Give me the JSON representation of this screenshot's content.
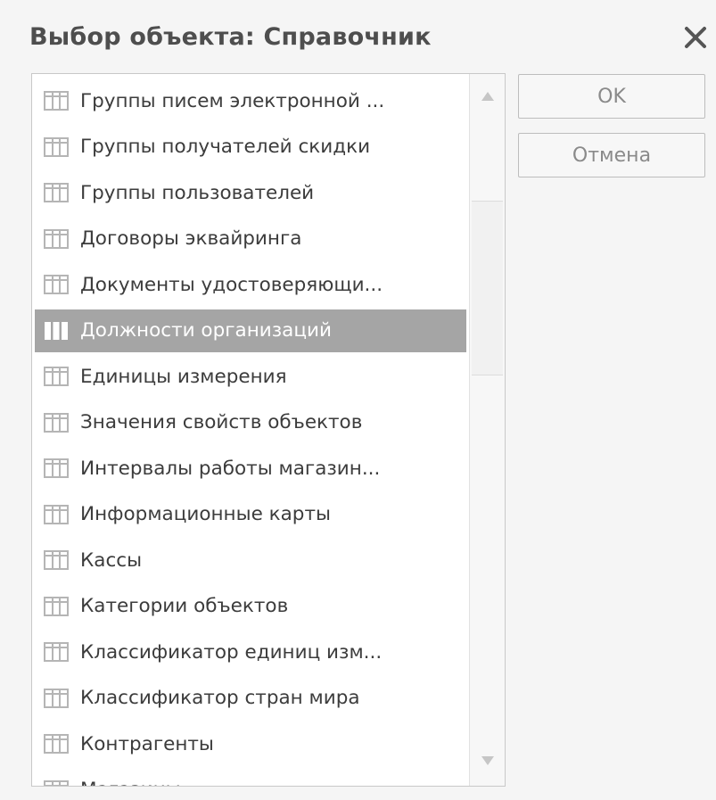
{
  "dialog": {
    "title": "Выбор объекта: Справочник",
    "close_icon": "close-icon"
  },
  "list": {
    "item_icon": "catalog-table-icon",
    "selected_index": 5,
    "items": [
      {
        "label": "Группы писем электронной ..."
      },
      {
        "label": "Группы получателей скидки"
      },
      {
        "label": "Группы пользователей"
      },
      {
        "label": "Договоры эквайринга"
      },
      {
        "label": "Документы удостоверяющи..."
      },
      {
        "label": "Должности организаций"
      },
      {
        "label": "Единицы измерения"
      },
      {
        "label": "Значения свойств объектов"
      },
      {
        "label": "Интервалы работы магазин..."
      },
      {
        "label": "Информационные карты"
      },
      {
        "label": "Кассы"
      },
      {
        "label": "Категории объектов"
      },
      {
        "label": "Классификатор единиц изм..."
      },
      {
        "label": "Классификатор стран мира"
      },
      {
        "label": "Контрагенты"
      },
      {
        "label": "Магазины"
      }
    ]
  },
  "buttons": {
    "ok_label": "OK",
    "cancel_label": "Отмена"
  },
  "colors": {
    "selection": "#a5a5a5",
    "text": "#3c3c3c",
    "title": "#4e4e4e",
    "button_text": "#8a8a8a"
  }
}
